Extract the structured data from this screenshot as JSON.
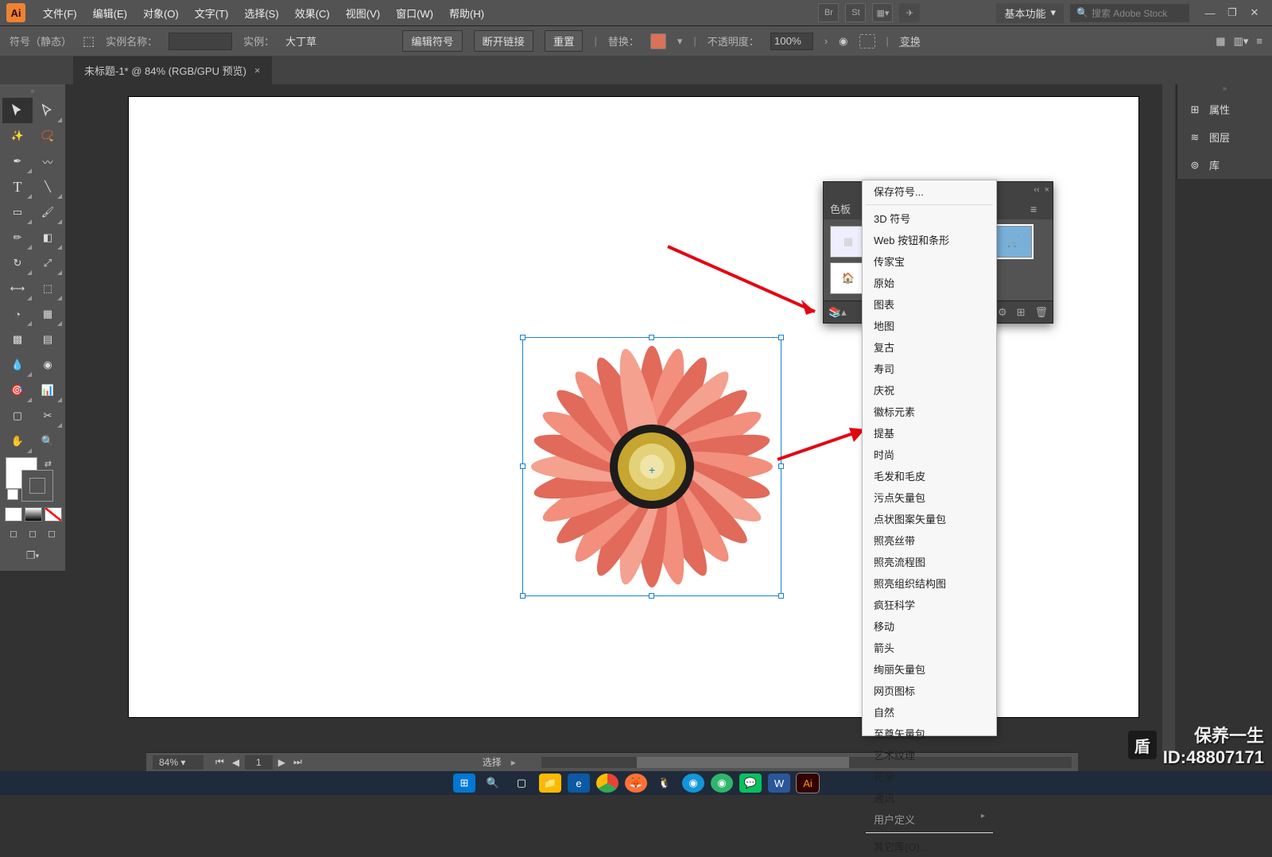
{
  "app": {
    "logo": "Ai"
  },
  "menus": [
    "文件(F)",
    "编辑(E)",
    "对象(O)",
    "文字(T)",
    "选择(S)",
    "效果(C)",
    "视图(V)",
    "窗口(W)",
    "帮助(H)"
  ],
  "top_right": {
    "br": "Br",
    "st": "St",
    "workspace": "基本功能",
    "search_placeholder": "搜索 Adobe Stock"
  },
  "control": {
    "symbol_label": "符号（静态）",
    "instance_name_label": "实例名称：",
    "instance_value": "",
    "instance_of_label": "实例：",
    "instance_of_value": "大丁草",
    "edit_symbol": "编辑符号",
    "break_link": "断开链接",
    "reset": "重置",
    "replace_label": "替换：",
    "opacity_label": "不透明度：",
    "opacity_value": "100%",
    "transform": "变换"
  },
  "tab": {
    "title": "未标题-1* @ 84% (RGB/GPU 预览)"
  },
  "right_panel": {
    "attributes": "属性",
    "layers": "图层",
    "library": "库"
  },
  "floating": {
    "tab_title": "色板",
    "collapse": "‹‹"
  },
  "context_menu": [
    {
      "t": "保存符号..."
    },
    {
      "sep": true
    },
    {
      "t": "3D 符号"
    },
    {
      "t": "Web 按钮和条形"
    },
    {
      "t": "传家宝"
    },
    {
      "t": "原始"
    },
    {
      "t": "图表"
    },
    {
      "t": "地图"
    },
    {
      "t": "复古"
    },
    {
      "t": "寿司"
    },
    {
      "t": "庆祝"
    },
    {
      "t": "徽标元素"
    },
    {
      "t": "提基"
    },
    {
      "t": "时尚"
    },
    {
      "t": "毛发和毛皮"
    },
    {
      "t": "污点矢量包"
    },
    {
      "t": "点状图案矢量包"
    },
    {
      "t": "照亮丝带"
    },
    {
      "t": "照亮流程图"
    },
    {
      "t": "照亮组织结构图"
    },
    {
      "t": "疯狂科学"
    },
    {
      "t": "移动"
    },
    {
      "t": "箭头"
    },
    {
      "t": "绚丽矢量包"
    },
    {
      "t": "网页图标"
    },
    {
      "t": "自然"
    },
    {
      "t": "至尊矢量包"
    },
    {
      "t": "艺术纹理"
    },
    {
      "t": "花朵"
    },
    {
      "t": "通讯"
    },
    {
      "t": "用户定义",
      "disabled": true,
      "sub": true
    },
    {
      "sep": true
    },
    {
      "t": "其它库(O)..."
    }
  ],
  "status": {
    "zoom": "84%",
    "page": "1",
    "tool": "选择"
  },
  "watermark": {
    "line1": "保养一生",
    "line2": "ID:48807171"
  },
  "swatches": [
    "grid",
    "cart",
    "home"
  ],
  "taskbar_apps": [
    "win",
    "search",
    "files",
    "edge",
    "chrome",
    "firefox",
    "qq",
    "qqbrowser",
    "browser360",
    "wechat",
    "word",
    "illustrator"
  ]
}
